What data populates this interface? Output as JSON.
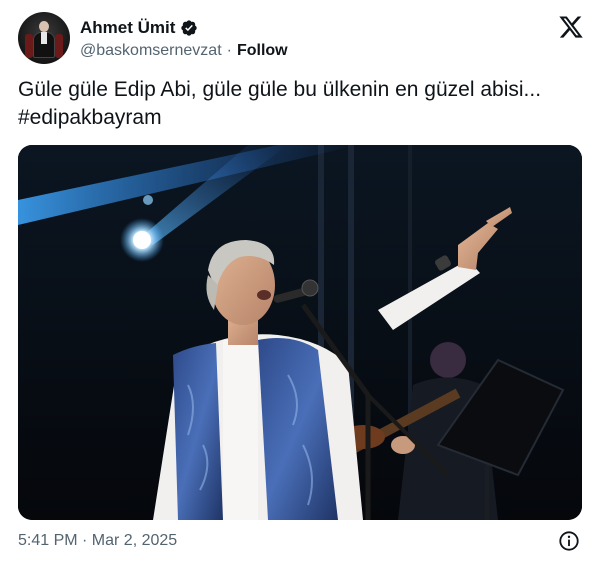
{
  "author": {
    "display_name": "Ahmet Ümit",
    "handle": "@baskomsernevzat",
    "separator": "·",
    "follow_label": "Follow",
    "verified_color": "#0f1419",
    "avatar_icon": "person-avatar"
  },
  "tweet": {
    "text_line1": "Güle güle Edip Abi, güle güle bu ülkenin en güzel abisi...",
    "hashtag": "#edipakbayram"
  },
  "media": {
    "type": "photo",
    "subject": "singer-on-stage"
  },
  "footer": {
    "timestamp": "5:41 PM · Mar 2, 2025",
    "info_icon": "info-icon"
  },
  "brand": {
    "logo": "x-logo-icon",
    "text_color": "#0f1419",
    "secondary_color": "#536471"
  }
}
